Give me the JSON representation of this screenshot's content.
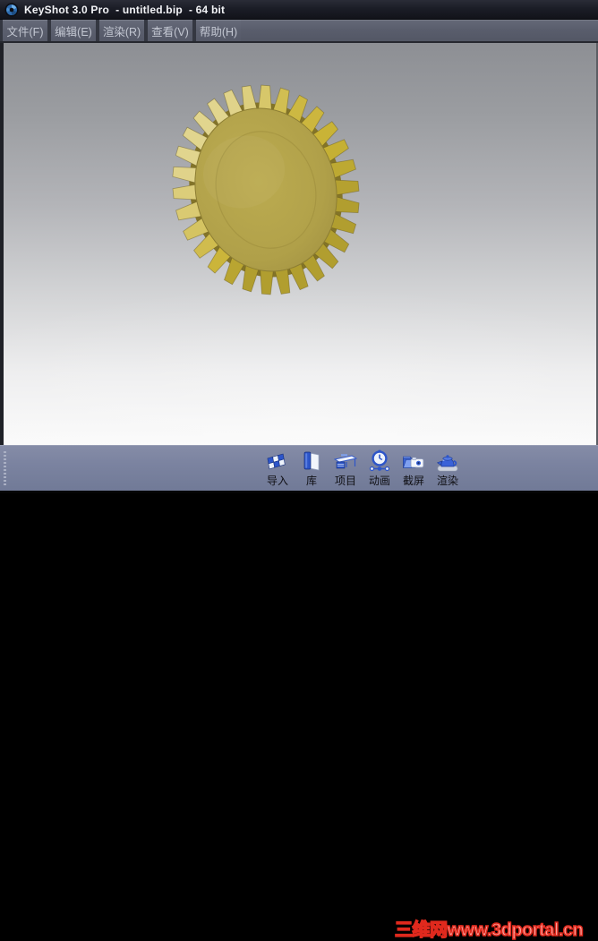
{
  "window": {
    "title": "KeyShot 3.0 Pro  - untitled.bip  - 64 bit",
    "logo_icon": "keyshot-aperture-icon"
  },
  "menu_bar": {
    "items": [
      {
        "label": "文件(F)"
      },
      {
        "label": "编辑(E)"
      },
      {
        "label": "渲染(R)"
      },
      {
        "label": "查看(V)"
      },
      {
        "label": "帮助(H)"
      }
    ]
  },
  "viewport": {
    "model": "golden bevel gear, 30 teeth, tilted in perspective",
    "background_top_color": "#8d8f94",
    "background_bottom_color": "#fafafa",
    "gear_face_color": "#b3a452",
    "gear_bright_tooth_color": "#ecdc82",
    "gear_dark_tooth_color": "#9c8b30"
  },
  "toolbar": {
    "items": [
      {
        "label": "导入",
        "icon": "import-icon"
      },
      {
        "label": "库",
        "icon": "library-icon"
      },
      {
        "label": "项目",
        "icon": "project-icon"
      },
      {
        "label": "动画",
        "icon": "animation-icon"
      },
      {
        "label": "截屏",
        "icon": "screenshot-icon"
      },
      {
        "label": "渲染",
        "icon": "render-icon"
      }
    ],
    "icon_blue": "#2e5bd0",
    "background_color": "#7b83a0"
  },
  "watermark": {
    "text": "三维网www.3dportal.cn",
    "color": "#e0291d"
  }
}
